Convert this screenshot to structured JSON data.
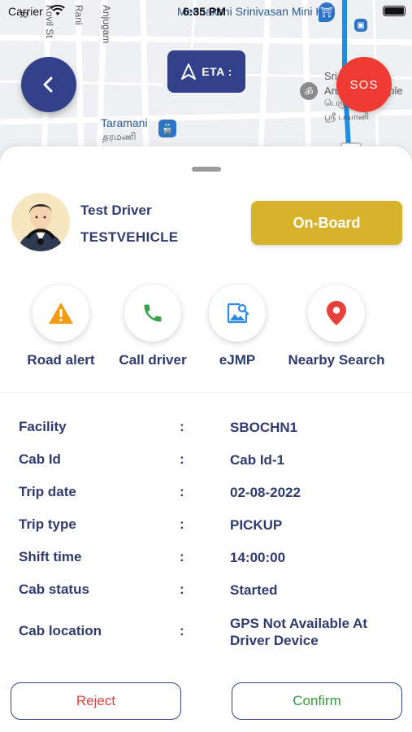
{
  "status_bar": {
    "carrier": "Carrier",
    "time": "6:35 PM"
  },
  "map": {
    "labels": {
      "hall": "Meenakshi Srinivasan Mini Hall",
      "taramani": "Taramani",
      "taramani_tamil": "தரமணி",
      "sri": "Sri",
      "temple": "Arulmigu Temple",
      "temple_tamil": "பெரு மையம்",
      "sri_tamil": "ஸ்ரீ பவானி",
      "street_kovil": "Kovil St",
      "street_rani": "Rani",
      "street_anju": "Anjugam",
      "street_r": "R"
    },
    "eta_label": "ETA :",
    "sos_label": "SOS"
  },
  "driver": {
    "name": "Test Driver",
    "vehicle": "TESTVEHICLE",
    "onboard_label": "On-Board"
  },
  "actions": [
    {
      "label": "Road alert",
      "icon": "warning-icon",
      "color": "#f39c12"
    },
    {
      "label": "Call driver",
      "icon": "phone-icon",
      "color": "#3aa14b"
    },
    {
      "label": "eJMP",
      "icon": "image-search-icon",
      "color": "#2a8be0"
    },
    {
      "label": "Nearby Search",
      "icon": "location-pin-icon",
      "color": "#e8413b"
    }
  ],
  "details": [
    {
      "key": "Facility",
      "colon": ":",
      "value": "SBOCHN1"
    },
    {
      "key": "Cab Id",
      "colon": ":",
      "value": "Cab Id-1"
    },
    {
      "key": "Trip date",
      "colon": ":",
      "value": "02-08-2022"
    },
    {
      "key": "Trip type",
      "colon": ":",
      "value": "PICKUP"
    },
    {
      "key": "Shift time",
      "colon": ":",
      "value": "14:00:00"
    },
    {
      "key": "Cab status",
      "colon": ":",
      "value": "Started"
    },
    {
      "key": "Cab location",
      "colon": ":",
      "value": "GPS Not Available At Driver Device"
    }
  ],
  "buttons": {
    "reject": "Reject",
    "confirm": "Confirm"
  },
  "colors": {
    "primary": "#32418a",
    "accent_gold": "#d7b32b",
    "sos_red": "#ee3b33",
    "reject_red": "#e2403a",
    "confirm_green": "#2f9e3a"
  }
}
